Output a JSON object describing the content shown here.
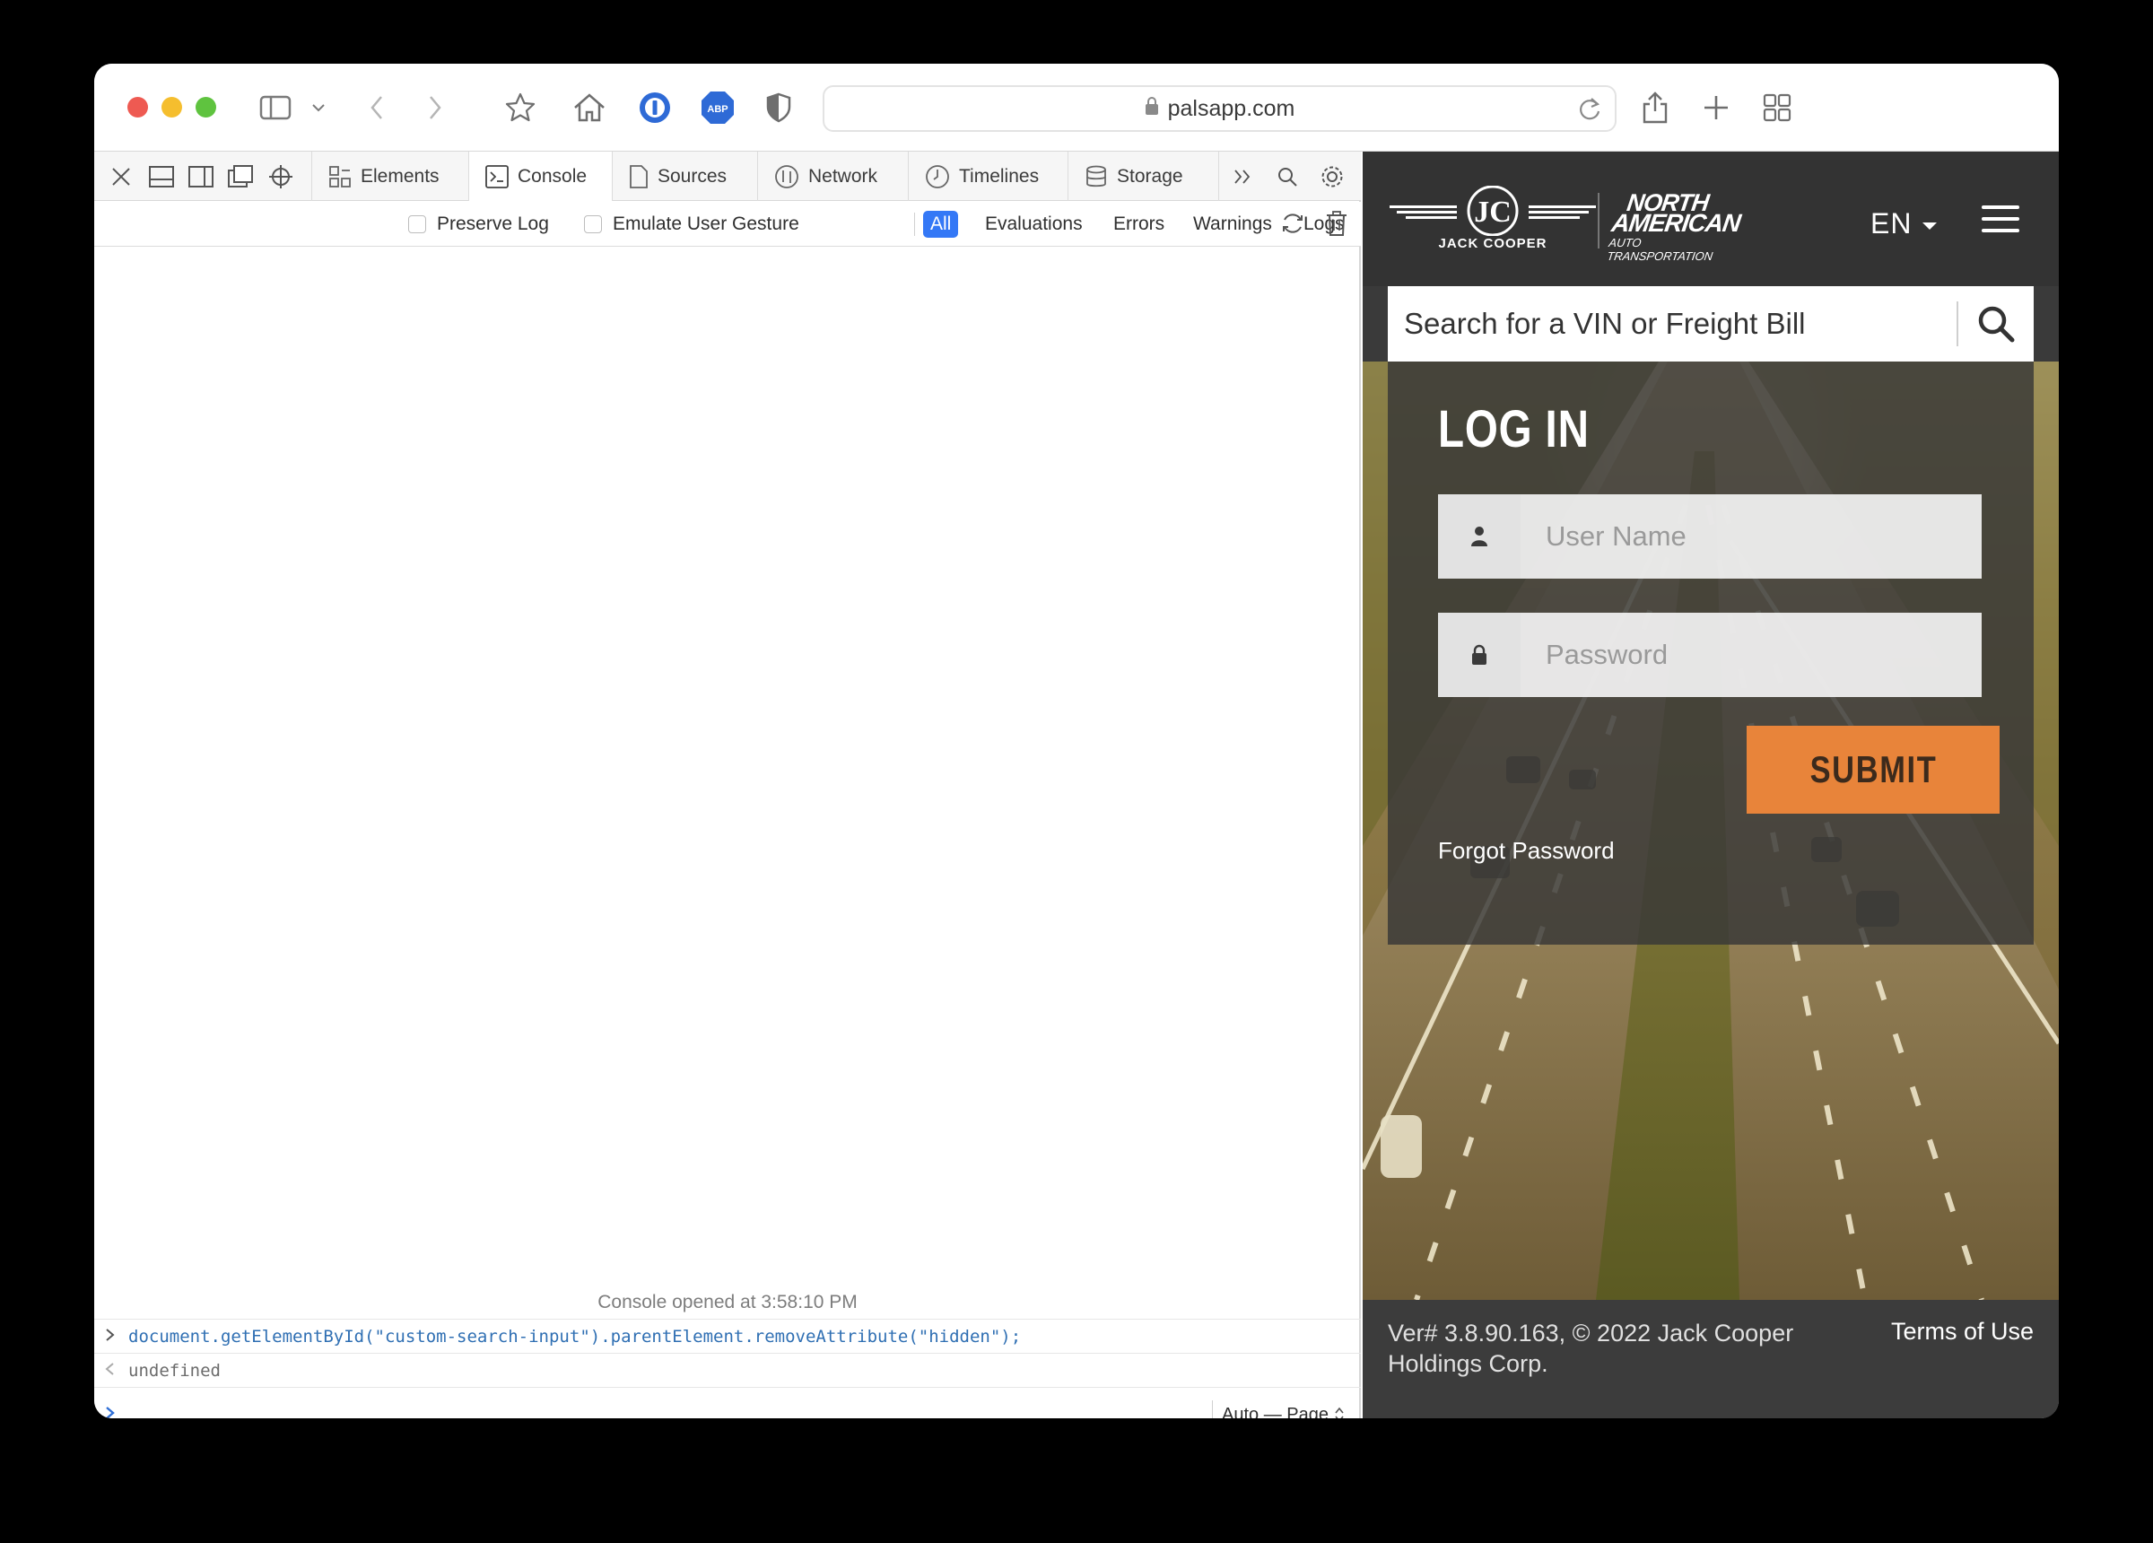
{
  "browser": {
    "url": "palsapp.com"
  },
  "devtools": {
    "tabs": [
      {
        "label": "Elements"
      },
      {
        "label": "Console"
      },
      {
        "label": "Sources"
      },
      {
        "label": "Network"
      },
      {
        "label": "Timelines"
      },
      {
        "label": "Storage"
      }
    ],
    "active_tab": "Console",
    "filter": {
      "preserve_log": "Preserve Log",
      "emulate_gesture": "Emulate User Gesture",
      "levels": [
        "All",
        "Evaluations",
        "Errors",
        "Warnings",
        "Logs"
      ],
      "active_level": "All"
    },
    "console": {
      "opened_text": "Console opened at 3:58:10 PM",
      "command": "document.getElementById(\"custom-search-input\").parentElement.removeAttribute(\"hidden\");",
      "result": "undefined",
      "context_selector": "Auto — Page"
    }
  },
  "site": {
    "logo_jc_text": "JACK COOPER",
    "logo_na_line1": "NORTH",
    "logo_na_line2": "AMERICAN",
    "logo_na_line3": "AUTO TRANSPORTATION",
    "language": "EN",
    "search_placeholder": "Search for a VIN or Freight Bill",
    "login": {
      "title": "LOG IN",
      "username_placeholder": "User Name",
      "password_placeholder": "Password",
      "submit_label": "SUBMIT",
      "forgot_label": "Forgot Password"
    },
    "footer": {
      "version": "Ver# 3.8.90.163, © 2022 Jack Cooper Holdings Corp.",
      "terms": "Terms of Use"
    },
    "colors": {
      "submit": "#e8843a",
      "header": "#333333"
    }
  }
}
